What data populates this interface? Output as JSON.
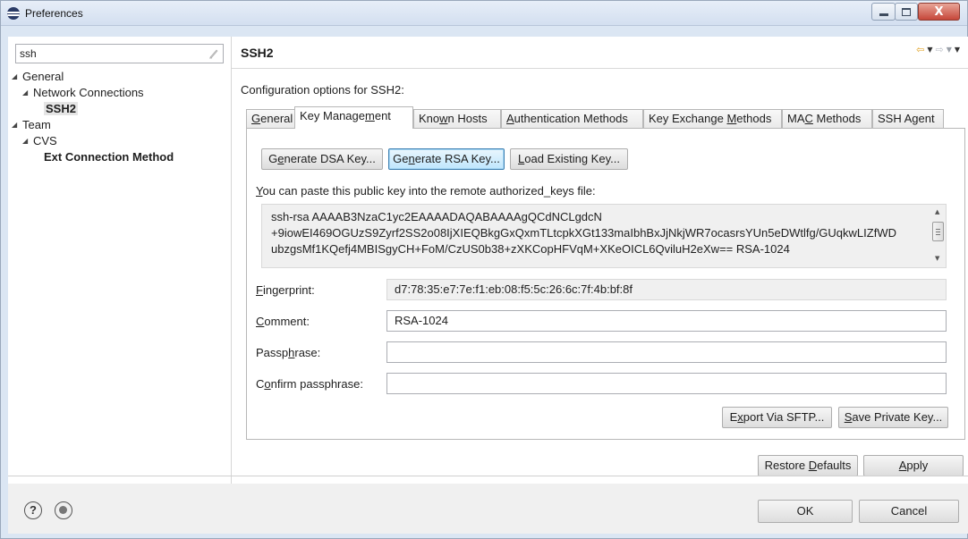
{
  "window": {
    "title": "Preferences",
    "close_glyph": "X"
  },
  "filter": {
    "value": "ssh"
  },
  "tree": {
    "general": "General",
    "network_connections": "Network Connections",
    "ssh2": "SSH2",
    "team": "Team",
    "cvs": "CVS",
    "ext_connection_method": "Ext Connection Method"
  },
  "page": {
    "title": "SSH2",
    "description": "Configuration options for SSH2:"
  },
  "tabs": {
    "general": {
      "mnemonic": "G",
      "rest": "eneral"
    },
    "key_management": {
      "prefix": "Key Manage",
      "mnemonic": "m",
      "rest": "ent"
    },
    "known_hosts": {
      "prefix": "Kno",
      "mnemonic": "w",
      "rest": "n Hosts"
    },
    "authentication_methods": {
      "mnemonic": "A",
      "rest": "uthentication Methods"
    },
    "key_exchange_methods": {
      "prefix": "Key Exchange ",
      "mnemonic": "M",
      "rest": "ethods"
    },
    "mac_methods": {
      "prefix": "MA",
      "mnemonic": "C",
      "rest": " Methods"
    },
    "ssh_agent": {
      "label": "SSH Agent"
    }
  },
  "key_management": {
    "generate_dsa": {
      "prefix": "G",
      "mnemonic": "e",
      "rest": "nerate DSA Key..."
    },
    "generate_rsa": {
      "prefix": "Ge",
      "mnemonic": "n",
      "rest": "erate RSA Key..."
    },
    "load_existing": {
      "mnemonic": "L",
      "rest": "oad Existing Key..."
    },
    "paste_label": {
      "mnemonic": "Y",
      "rest": "ou can paste this public key into the remote authorized_keys file:"
    },
    "public_key_lines": [
      "ssh-rsa AAAAB3NzaC1yc2EAAAADAQABAAAAgQCdNCLgdcN",
      "+9iowEI469OGUzS9Zyrf2SS2o08IjXIEQBkgGxQxmTLtcpkXGt133maIbhBxJjNkjWR7ocasrsYUn5eDWtlfg/GUqkwLIZfWD",
      "ubzgsMf1KQefj4MBISgyCH+FoM/CzUS0b38+zXKCopHFVqM+XKeOICL6QviluH2eXw== RSA-1024"
    ],
    "fingerprint_label": {
      "mnemonic": "F",
      "rest": "ingerprint:"
    },
    "fingerprint_value": "d7:78:35:e7:7e:f1:eb:08:f5:5c:26:6c:7f:4b:bf:8f",
    "comment_label": {
      "mnemonic": "C",
      "rest": "omment:"
    },
    "comment_value": "RSA-1024",
    "passphrase_label": {
      "prefix": "Passp",
      "mnemonic": "h",
      "rest": "rase:"
    },
    "passphrase_value": "",
    "confirm_label": {
      "prefix": "C",
      "mnemonic": "o",
      "rest": "nfirm passphrase:"
    },
    "confirm_value": "",
    "export_sftp": {
      "prefix": "E",
      "mnemonic": "x",
      "rest": "port Via SFTP..."
    },
    "save_private": {
      "mnemonic": "S",
      "rest": "ave Private Key..."
    }
  },
  "page_buttons": {
    "restore_defaults": {
      "prefix": "Restore ",
      "mnemonic": "D",
      "rest": "efaults"
    },
    "apply": {
      "mnemonic": "A",
      "rest": "pply"
    }
  },
  "dialog_buttons": {
    "ok": "OK",
    "cancel": "Cancel"
  },
  "footer": {
    "help_glyph": "?"
  }
}
